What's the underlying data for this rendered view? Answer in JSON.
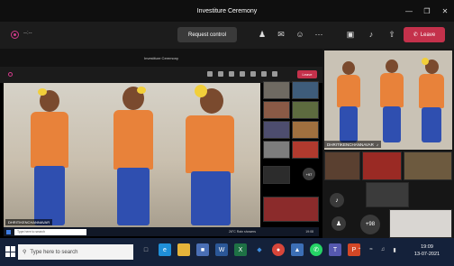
{
  "window": {
    "title": "Investiture Ceremony"
  },
  "toolbar": {
    "timer": "--:--",
    "request_control": "Request control",
    "leave": "Leave"
  },
  "shared_screen": {
    "title": "Investiture Ceremony",
    "leave": "Leave",
    "presenter_tag": "DHRITIKENCHANNAVAR",
    "inner_search": "Type here to search",
    "inner_weather": "26°C Rain showers",
    "inner_time": "19:08",
    "grid_more": "+97",
    "grid_label": "Leave"
  },
  "right_pane": {
    "spotlight_name": "DHRITIKENCHANNAVAR",
    "more_count": "+98"
  },
  "taskbar": {
    "search_placeholder": "Type here to search",
    "time": "19:09",
    "date": "13-07-2021"
  },
  "colors": {
    "leave": "#c4314b",
    "recording": "#d13a8a",
    "costume_orange": "#e8823a",
    "costume_blue": "#2f4fb0"
  }
}
